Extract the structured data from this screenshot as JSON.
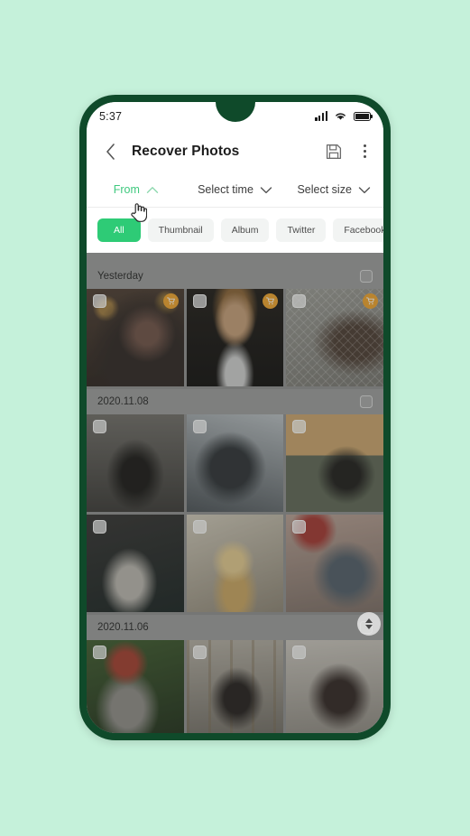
{
  "background_color": "#c5f1da",
  "device": {
    "frame_color": "#0f4a2a",
    "notch": "waterdrop-notch"
  },
  "status_bar": {
    "time": "5:37",
    "icons": [
      "signal-bars-icon",
      "wifi-icon",
      "battery-icon"
    ]
  },
  "app_bar": {
    "back_icon": "chevron-left-icon",
    "title": "Recover Photos",
    "save_icon": "floppy-disk-save-icon",
    "menu_icon": "overflow-menu-icon"
  },
  "filters": [
    {
      "label": "From",
      "state": "active",
      "chevron": "chevron-up-icon",
      "accent": "#3fc97e"
    },
    {
      "label": "Select time",
      "state": "inactive",
      "chevron": "chevron-down-icon",
      "accent": "#3c3c3c"
    },
    {
      "label": "Select size",
      "state": "inactive",
      "chevron": "chevron-down-icon",
      "accent": "#3c3c3c"
    }
  ],
  "cursor": {
    "type": "pointing-hand-cursor",
    "over": "From"
  },
  "chips": {
    "selected_color": "#2ecb76",
    "items": [
      {
        "label": "All",
        "selected": true
      },
      {
        "label": "Thumbnail",
        "selected": false
      },
      {
        "label": "Album",
        "selected": false
      },
      {
        "label": "Twitter",
        "selected": false
      },
      {
        "label": "Facebook",
        "selected": false
      }
    ]
  },
  "gallery": {
    "badge_color": "#f0a32a",
    "groups": [
      {
        "date": "Yesterday",
        "group_checkbox": "unchecked",
        "photos": [
          {
            "alt": "woman-long-dark-hair-bokeh-lights",
            "checkbox": "unchecked",
            "badge": "cart-badge"
          },
          {
            "alt": "man-in-suit-and-tie-dark",
            "checkbox": "unchecked",
            "badge": "cart-badge"
          },
          {
            "alt": "woman-beanie-chainlink-fence",
            "checkbox": "unchecked",
            "badge": "cart-badge"
          }
        ]
      },
      {
        "date": "2020.11.08",
        "group_checkbox": "unchecked",
        "photos": [
          {
            "alt": "man-sitting-stone-archway",
            "checkbox": "unchecked",
            "badge": null
          },
          {
            "alt": "man-beanie-snow-forest",
            "checkbox": "unchecked",
            "badge": null
          },
          {
            "alt": "woman-black-top-sunset-lake",
            "checkbox": "unchecked",
            "badge": null
          },
          {
            "alt": "man-glasses-dark-room-frames",
            "checkbox": "unchecked",
            "badge": null
          },
          {
            "alt": "blonde-woman-yellow-top-sun",
            "checkbox": "unchecked",
            "badge": null
          },
          {
            "alt": "woman-sunglasses-street-pink",
            "checkbox": "unchecked",
            "badge": null
          }
        ]
      },
      {
        "date": "2020.11.06",
        "group_checkbox": "unchecked",
        "photos": [
          {
            "alt": "bearded-man-red-cap-plants",
            "checkbox": "unchecked",
            "badge": null
          },
          {
            "alt": "woman-black-dress-wooden-rail",
            "checkbox": "unchecked",
            "badge": null
          },
          {
            "alt": "woman-brown-coat-looking-up",
            "checkbox": "unchecked",
            "badge": null
          }
        ]
      }
    ]
  },
  "scroll_indicator": {
    "icon": "scroll-up-down-icon"
  }
}
